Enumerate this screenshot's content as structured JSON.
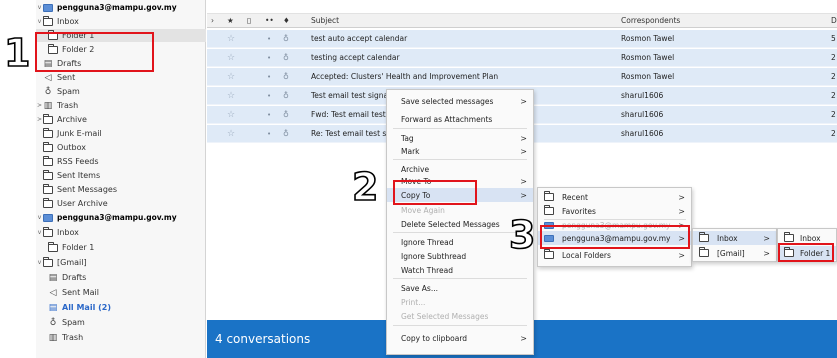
{
  "folder_pane": {
    "items": [
      {
        "label": "pengguna3@mampu.gov.my",
        "type": "account",
        "icon": "account-icon",
        "twisty": "v"
      },
      {
        "label": "Inbox",
        "type": "folder",
        "icon": "inbox-icon",
        "twisty": "v"
      },
      {
        "label": "Folder 1",
        "type": "folder",
        "icon": "folder-icon"
      },
      {
        "label": "Folder 2",
        "type": "folder",
        "icon": "folder-icon"
      },
      {
        "label": "Drafts",
        "type": "folder",
        "icon": "drafts-icon"
      },
      {
        "label": "Sent",
        "type": "folder",
        "icon": "sent-icon"
      },
      {
        "label": "Spam",
        "type": "folder",
        "icon": "spam-icon"
      },
      {
        "label": "Trash",
        "type": "folder",
        "icon": "trash-icon",
        "twisty": ">"
      },
      {
        "label": "Archive",
        "type": "folder",
        "icon": "folder-icon",
        "twisty": ">"
      },
      {
        "label": "Junk E-mail",
        "type": "folder",
        "icon": "folder-icon"
      },
      {
        "label": "Outbox",
        "type": "folder",
        "icon": "folder-icon"
      },
      {
        "label": "RSS Feeds",
        "type": "folder",
        "icon": "folder-icon"
      },
      {
        "label": "Sent Items",
        "type": "folder",
        "icon": "folder-icon"
      },
      {
        "label": "Sent Messages",
        "type": "folder",
        "icon": "folder-icon"
      },
      {
        "label": "User Archive",
        "type": "folder",
        "icon": "folder-icon"
      },
      {
        "label": "pengguna3@mampu.gov.my",
        "type": "account",
        "icon": "account-icon",
        "twisty": "v"
      },
      {
        "label": "Inbox",
        "type": "folder",
        "icon": "inbox-icon",
        "twisty": "v"
      },
      {
        "label": "Folder 1",
        "type": "folder",
        "icon": "folder-icon"
      },
      {
        "label": "[Gmail]",
        "type": "folder",
        "icon": "folder-icon",
        "twisty": "v"
      },
      {
        "label": "Drafts",
        "type": "folder",
        "icon": "drafts-icon"
      },
      {
        "label": "Sent Mail",
        "type": "folder",
        "icon": "sent-icon"
      },
      {
        "label": "All Mail (2)",
        "type": "folder",
        "icon": "folder-icon",
        "highlight": true
      },
      {
        "label": "Spam",
        "type": "folder",
        "icon": "spam-icon"
      },
      {
        "label": "Trash",
        "type": "folder",
        "icon": "trash-icon"
      }
    ]
  },
  "message_list": {
    "columns": {
      "subject": "Subject",
      "correspondents": "Correspondents",
      "date": "D"
    },
    "rows": [
      {
        "subject": "test auto accept calendar",
        "correspondent": "Rosmon Tawel",
        "date": "5"
      },
      {
        "subject": "testing accept calendar",
        "correspondent": "Rosmon Tawel",
        "date": "2"
      },
      {
        "subject": "Accepted: Clusters' Health and Improvement Plan",
        "correspondent": "Rosmon Tawel",
        "date": "2"
      },
      {
        "subject": "Test email test signa",
        "correspondent": "sharul1606",
        "date": "2"
      },
      {
        "subject": "Fwd: Test email test",
        "correspondent": "sharul1606",
        "date": "2"
      },
      {
        "subject": "Re: Test email test si",
        "correspondent": "sharul1606",
        "date": "2"
      }
    ],
    "banner": "4 conversations"
  },
  "context_menu": {
    "items": [
      {
        "label": "Save selected messages",
        "arrow": true
      },
      {
        "label": "Forward as Attachments"
      },
      {
        "label": "Tag",
        "arrow": true
      },
      {
        "label": "Mark",
        "arrow": true
      },
      {
        "label": "Archive"
      },
      {
        "label": "Move To",
        "arrow": true
      },
      {
        "label": "Copy To",
        "arrow": true
      },
      {
        "label": "Move Again",
        "disabled": true
      },
      {
        "label": "Delete Selected Messages"
      },
      {
        "label": "Ignore Thread"
      },
      {
        "label": "Ignore Subthread"
      },
      {
        "label": "Watch Thread"
      },
      {
        "label": "Save As..."
      },
      {
        "label": "Print...",
        "disabled": true
      },
      {
        "label": "Get Selected Messages",
        "disabled": true
      },
      {
        "label": "Copy to clipboard",
        "arrow": true
      }
    ]
  },
  "submenu_copy": {
    "items": [
      {
        "label": "Recent",
        "arrow": true
      },
      {
        "label": "Favorites",
        "arrow": true
      },
      {
        "label": "pengguna3@mampu.gov.my",
        "arrow": true
      },
      {
        "label": "pengguna3@mampu.gov.my",
        "arrow": true
      },
      {
        "label": "Local Folders",
        "arrow": true
      }
    ]
  },
  "submenu_account": {
    "items": [
      {
        "label": "Inbox",
        "arrow": true
      },
      {
        "label": "[Gmail]",
        "arrow": true
      }
    ]
  },
  "submenu_inbox": {
    "items": [
      {
        "label": "Inbox"
      },
      {
        "label": "Folder 1"
      }
    ]
  },
  "annotations": {
    "step1": "1",
    "step2": "2",
    "step3": "3"
  },
  "colors": {
    "accent": "#1a73c6",
    "selection": "#dfeaf7",
    "annotation": "#e1141b"
  }
}
